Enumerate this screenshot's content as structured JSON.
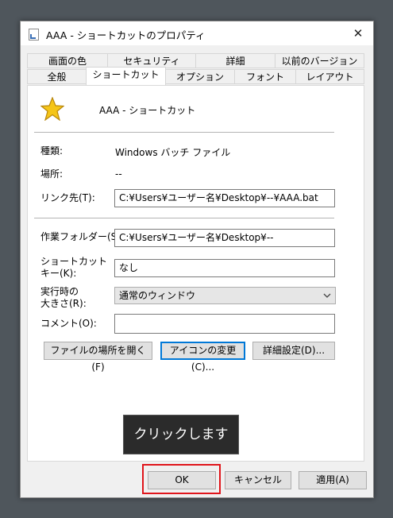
{
  "window": {
    "title": "AAA - ショートカットのプロパティ"
  },
  "tabs": {
    "row1": [
      "画面の色",
      "セキュリティ",
      "詳細",
      "以前のバージョン"
    ],
    "row2": [
      "全般",
      "ショートカット",
      "オプション",
      "フォント",
      "レイアウト"
    ],
    "active": "ショートカット"
  },
  "shortcut": {
    "name": "AAA - ショートカット",
    "type_label": "種類:",
    "type_value": "Windows バッチ ファイル",
    "location_label": "場所:",
    "location_value": "--",
    "target_label": "リンク先(T):",
    "target_value": "C:¥Users¥ユーザー名¥Desktop¥--¥AAA.bat",
    "startin_label": "作業フォルダー(S):",
    "startin_value": "C:¥Users¥ユーザー名¥Desktop¥--",
    "hotkey_label_line1": "ショートカット",
    "hotkey_label_line2": "キー(K):",
    "hotkey_value": "なし",
    "run_label_line1": "実行時の",
    "run_label_line2": "大きさ(R):",
    "run_value": "通常のウィンドウ",
    "comment_label": "コメント(O):",
    "comment_value": ""
  },
  "buttons": {
    "open_location": "ファイルの場所を開く(F)",
    "change_icon": "アイコンの変更(C)...",
    "advanced": "詳細設定(D)...",
    "ok": "OK",
    "cancel": "キャンセル",
    "apply": "適用(A)"
  },
  "tooltip": {
    "text": "クリックします"
  },
  "colors": {
    "highlight": "#e0151b",
    "focus": "#0078d7",
    "star": "#f5c518"
  },
  "icons": {
    "title": "shortcut-file-icon",
    "shortcut": "star-icon",
    "close": "close-icon"
  }
}
